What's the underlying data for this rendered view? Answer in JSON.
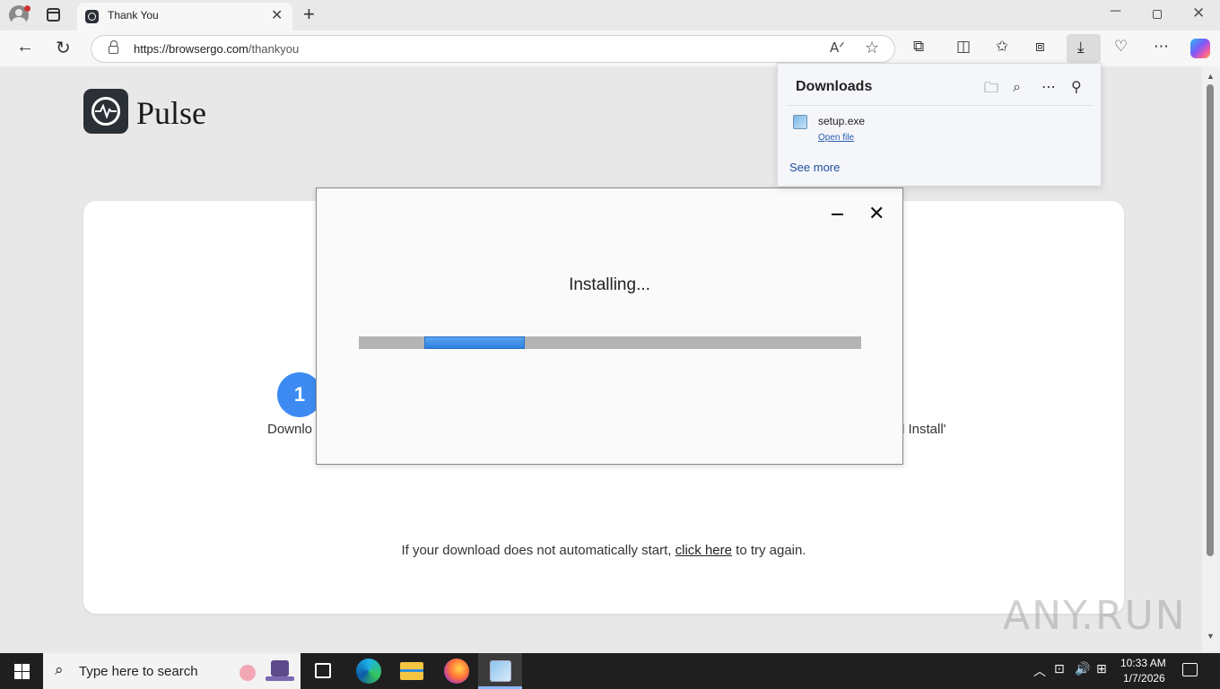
{
  "browser": {
    "tab_title": "Thank You",
    "tab_close_glyph": "✕",
    "new_tab_glyph": "+",
    "window_min_glyph": "─",
    "window_close_glyph": "✕",
    "url_host": "https://browsergo.com",
    "url_path": "/thankyou",
    "back_glyph": "←",
    "refresh_glyph": "↻",
    "read_aloud_glyph": "Aᐟ",
    "favorite_glyph": "☆",
    "icons": [
      "extensions-icon",
      "split-screen-icon",
      "favorites-icon",
      "collections-icon",
      "downloads-icon",
      "browser-essentials-icon",
      "more-icon",
      "copilot-icon"
    ]
  },
  "page": {
    "brand_name": "Pulse",
    "step_number": "1",
    "step_left_label": "Downlo",
    "step_right_label": "l Install'",
    "retry_prefix": "If your download does not automatically start, ",
    "retry_link": "click here",
    "retry_suffix": " to try again."
  },
  "installer": {
    "status": "Installing...",
    "close_glyph": "✕",
    "progress_fraction": 0.2
  },
  "downloads": {
    "title": "Downloads",
    "file_name": "setup.exe",
    "open_file": "Open file",
    "see_more": "See more"
  },
  "taskbar": {
    "search_placeholder": "Type here to search",
    "time": "10:33 AM",
    "date": "1/7/2026"
  },
  "watermark": "ANY.RUN",
  "colors": {
    "accent": "#3d8bf2",
    "progress_blue": "#2c7fe0",
    "logo_dark": "#2b2f36"
  }
}
